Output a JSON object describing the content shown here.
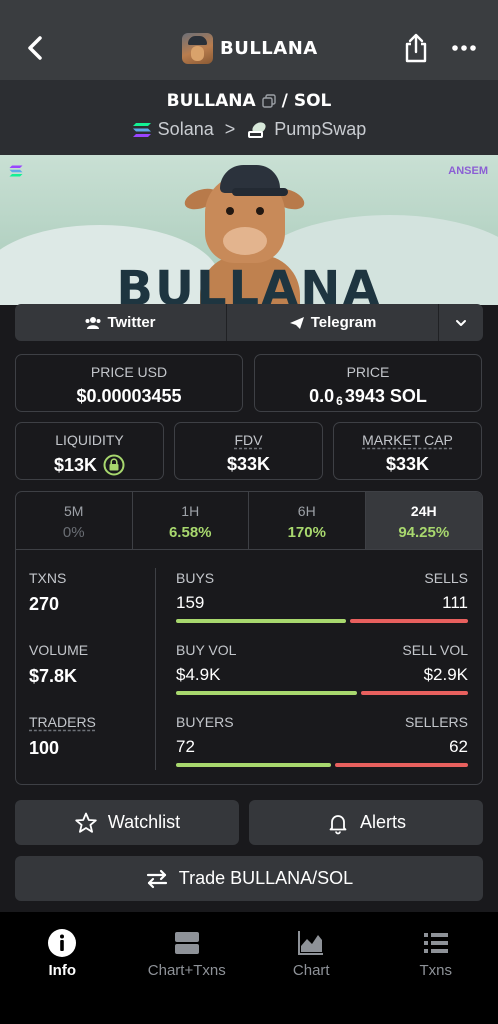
{
  "header": {
    "title": "BULLANA"
  },
  "pair": {
    "base": "BULLANA",
    "separator": "/",
    "quote": "SOL",
    "chain": "Solana",
    "chevron": ">",
    "dex": "PumpSwap"
  },
  "banner": {
    "word": "BULLANA",
    "tag": "ANSEM"
  },
  "socials": {
    "twitter": "Twitter",
    "telegram": "Telegram"
  },
  "price_usd": {
    "label": "PRICE USD",
    "value": "$0.00003455"
  },
  "price": {
    "label": "PRICE",
    "prefix": "0.0",
    "zeros": "6",
    "rest": "3943 SOL"
  },
  "liquidity": {
    "label": "LIQUIDITY",
    "value": "$13K"
  },
  "fdv": {
    "label": "FDV",
    "value": "$33K"
  },
  "market_cap": {
    "label": "MARKET CAP",
    "value": "$33K"
  },
  "tabs": [
    {
      "label": "5M",
      "value": "0%"
    },
    {
      "label": "1H",
      "value": "6.58%"
    },
    {
      "label": "6H",
      "value": "170%"
    },
    {
      "label": "24H",
      "value": "94.25%"
    }
  ],
  "stats": {
    "txns": {
      "label": "TXNS",
      "value": "270"
    },
    "volume": {
      "label": "VOLUME",
      "value": "$7.8K"
    },
    "traders": {
      "label": "TRADERS",
      "value": "100"
    },
    "buys": {
      "left_label": "BUYS",
      "right_label": "SELLS",
      "left": "159",
      "right": "111",
      "left_share": 0.589
    },
    "vol": {
      "left_label": "BUY VOL",
      "right_label": "SELL VOL",
      "left": "$4.9K",
      "right": "$2.9K",
      "left_share": 0.628
    },
    "buyers": {
      "left_label": "BUYERS",
      "right_label": "SELLERS",
      "left": "72",
      "right": "62",
      "left_share": 0.537
    }
  },
  "actions": {
    "watchlist": "Watchlist",
    "alerts": "Alerts",
    "trade": "Trade BULLANA/SOL"
  },
  "nav": [
    {
      "label": "Info",
      "icon": "info-icon"
    },
    {
      "label": "Chart+Txns",
      "icon": "chart-txns-icon"
    },
    {
      "label": "Chart",
      "icon": "chart-icon"
    },
    {
      "label": "Txns",
      "icon": "list-icon"
    }
  ],
  "colors": {
    "green": "#a8d86e",
    "red": "#e8605e",
    "panel": "#35373b",
    "background": "#19191c"
  }
}
